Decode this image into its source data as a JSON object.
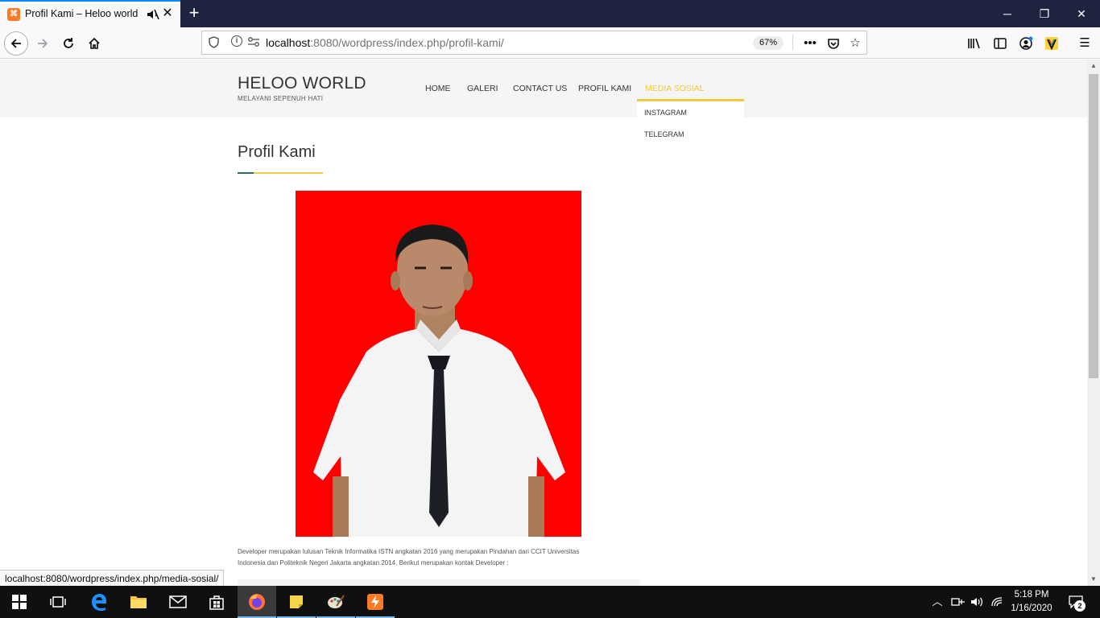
{
  "browser": {
    "tab_title": "Profil Kami – Heloo world",
    "tab_favicon_glyph": "⌘",
    "url_host": "localhost",
    "url_path": ":8080/wordpress/index.php/profil-kami/",
    "zoom": "67%",
    "status_link": "localhost:8080/wordpress/index.php/media-sosial/"
  },
  "site": {
    "title": "HELOO WORLD",
    "tagline": "MELAYANI SEPENUH HATI",
    "menu": {
      "home": "HOME",
      "galeri": "GALERI",
      "contact": "CONTACT US",
      "profil": "PROFIL KAMI",
      "media": "MEDIA SOSIAL"
    },
    "submenu": {
      "instagram": "INSTAGRAM",
      "telegram": "TELEGRAM"
    },
    "accent_color": "#f0c93e"
  },
  "content": {
    "page_title": "Profil Kami",
    "paragraph_line1": "Developer merupakan lulusan Teknik Informatika ISTN angkatan 2016 yang merupakan Pindahan dari CCIT Universitas",
    "paragraph_line2": "Indonesia dan Politeknik Negeri Jakarta angkatan 2014. Berikut merupakan kontak Developer :"
  },
  "taskbar": {
    "time": "5:18 PM",
    "date": "1/16/2020",
    "notification_count": "2"
  }
}
